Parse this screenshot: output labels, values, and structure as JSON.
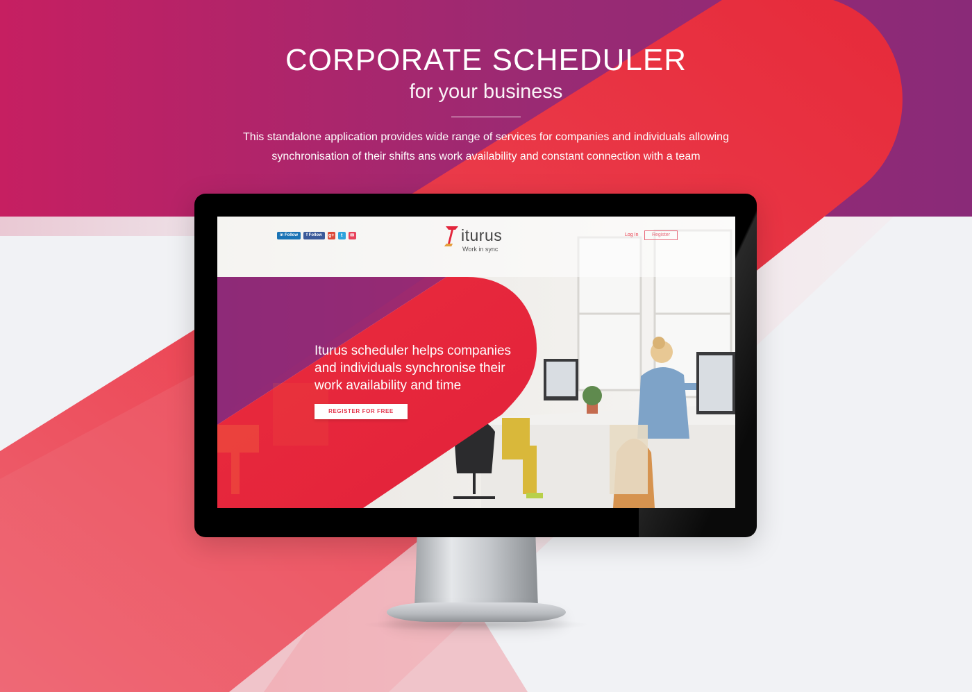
{
  "header": {
    "title": "CORPORATE SCHEDULER",
    "subtitle": "for your business",
    "description_line1": "This standalone application provides wide range of services for companies and individuals allowing",
    "description_line2": "synchronisation of their shifts ans work availability and constant connection with a team"
  },
  "site": {
    "social": {
      "linkedin_label": "Follow",
      "facebook_label": "Follow",
      "google_glyph": "g+",
      "twitter_glyph": "t",
      "mail_glyph": "✉"
    },
    "logo": {
      "name": "iturus",
      "tagline": "Work in sync"
    },
    "nav": {
      "login": "Log In",
      "register": "Register"
    },
    "hero": {
      "headline": "Iturus scheduler helps companies and individuals synchronise their work availability and time",
      "cta": "REGISTER FOR FREE"
    }
  },
  "colors": {
    "magenta": "#c8205f",
    "purple": "#8e2a78",
    "red": "#ea2f3c",
    "coral": "#ee6472",
    "background": "#f1f2f5"
  }
}
